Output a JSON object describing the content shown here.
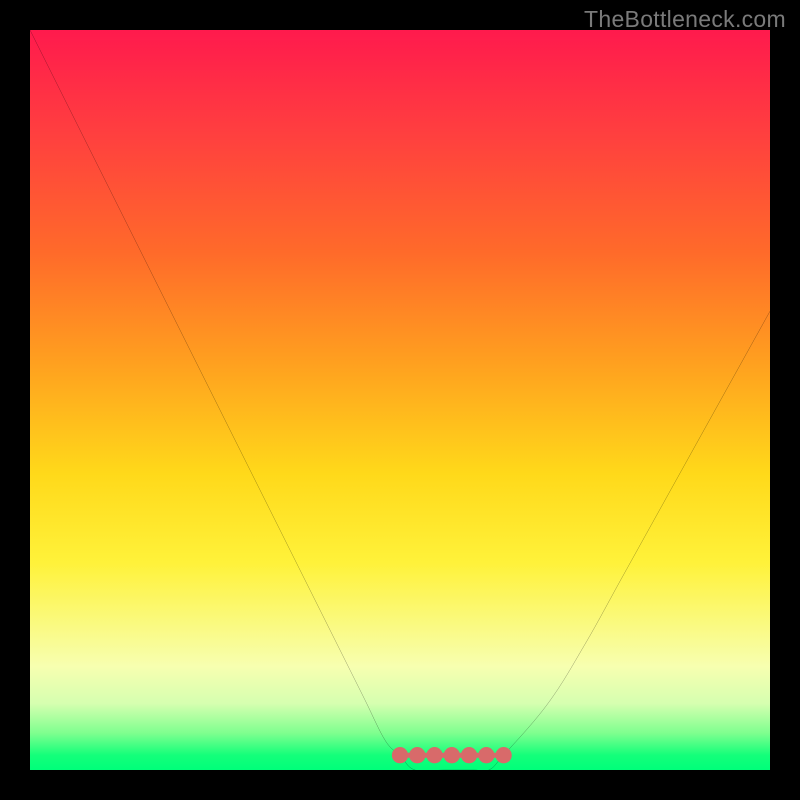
{
  "watermark": "TheBottleneck.com",
  "chart_data": {
    "type": "line",
    "title": "",
    "xlabel": "",
    "ylabel": "",
    "xlim": [
      0,
      100
    ],
    "ylim": [
      0,
      100
    ],
    "legend": false,
    "grid": false,
    "background_gradient_stops": [
      {
        "pos": 0,
        "color": "#ff1a4d"
      },
      {
        "pos": 14,
        "color": "#ff3f3f"
      },
      {
        "pos": 30,
        "color": "#ff6a2a"
      },
      {
        "pos": 45,
        "color": "#ffa01f"
      },
      {
        "pos": 60,
        "color": "#ffd91a"
      },
      {
        "pos": 72,
        "color": "#fff23a"
      },
      {
        "pos": 86,
        "color": "#f7ffb0"
      },
      {
        "pos": 91,
        "color": "#d6ffb0"
      },
      {
        "pos": 95,
        "color": "#7fff8f"
      },
      {
        "pos": 98,
        "color": "#14ff7a"
      },
      {
        "pos": 100,
        "color": "#00ff7a"
      }
    ],
    "series": [
      {
        "name": "bottleneck-curve",
        "color": "#000000",
        "stroke_width": 1.4,
        "x": [
          0,
          5,
          10,
          15,
          20,
          25,
          30,
          35,
          40,
          45,
          48,
          50,
          52,
          56,
          60,
          62,
          64,
          70,
          75,
          80,
          85,
          90,
          95,
          100
        ],
        "y": [
          100,
          90,
          80,
          70,
          60,
          50,
          40,
          30,
          20,
          10,
          4,
          2,
          0,
          0,
          0,
          0,
          2,
          9,
          17,
          26,
          35,
          44,
          53,
          62
        ]
      }
    ],
    "marker_band": {
      "name": "optimal-range",
      "color": "#d86a6a",
      "y": 2,
      "x_start": 50,
      "x_end": 64,
      "marker_count": 7,
      "marker_radius_pct": 1.1,
      "stroke_width": 5
    }
  }
}
